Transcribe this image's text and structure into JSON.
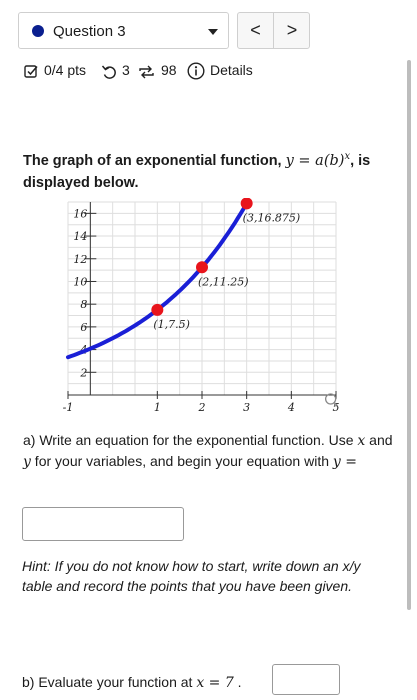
{
  "header": {
    "question_label": "Question 3",
    "question_dot_color": "#0a1f8f",
    "prev_label": "<",
    "next_label": ">"
  },
  "meta": {
    "score": "0/4 pts",
    "retries": "3",
    "submissions": "98",
    "details": "Details",
    "score_icon": "checkbox-edit-icon",
    "retry_icon": "undo-icon",
    "submissions_icon": "repeat-icon",
    "details_icon": "info-icon"
  },
  "problem": {
    "statement_pre": "The graph of an exponential function, ",
    "statement_math": "y = a(b)",
    "statement_exp": "x",
    "statement_post": ", is displayed below."
  },
  "chart_data": {
    "type": "line",
    "x_ticks": [
      "-1",
      "1",
      "2",
      "3",
      "4",
      "5"
    ],
    "y_ticks": [
      "2",
      "4",
      "6",
      "8",
      "10",
      "12",
      "14",
      "16"
    ],
    "xlim": [
      -1,
      5
    ],
    "ylim": [
      0,
      17
    ],
    "grid": true,
    "line_color": "#1a1fd6",
    "point_color": "#e8141c",
    "curve": {
      "a": 5,
      "b": 1.5,
      "x_from": -1,
      "x_to": 3
    },
    "points": [
      {
        "x": 1,
        "y": 7.5,
        "label": "(1,7.5)"
      },
      {
        "x": 2,
        "y": 11.25,
        "label": "(2,11.25)"
      },
      {
        "x": 3,
        "y": 16.875,
        "label": "(3,16.875)"
      }
    ]
  },
  "part_a": {
    "text1": "a) Write an equation for the exponential function. Use ",
    "var_x": "x",
    "text2": " and ",
    "var_y": "y",
    "text3": " for your variables, and begin your equation with ",
    "eq_start": "y =",
    "hint": "Hint: If you do not know how to start, write down an x/y table and record the points that you have been given."
  },
  "part_b": {
    "text": "b) Evaluate your function at ",
    "math": "x = 7",
    "period": " ."
  }
}
